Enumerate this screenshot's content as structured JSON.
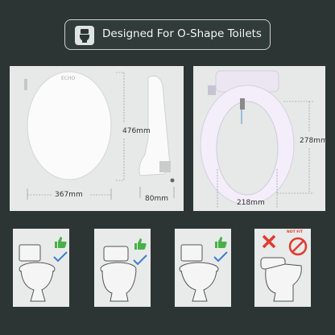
{
  "banner": {
    "title": "Designed For O-Shape Toilets",
    "icon": "toilet-icon"
  },
  "dimensions": {
    "height": "476mm",
    "width": "367mm",
    "depth": "80mm",
    "opening_height": "278mm",
    "opening_width": "218mm"
  },
  "product_brand": "ECHO",
  "compatibility": [
    {
      "toilet": "two-piece-round",
      "status": "check"
    },
    {
      "toilet": "one-piece-round",
      "status": "check"
    },
    {
      "toilet": "two-piece-elongated",
      "status": "check"
    },
    {
      "toilet": "smart-toilet",
      "status": "cross",
      "badge": "NOT FIT"
    }
  ],
  "colors": {
    "background": "#2c3533",
    "panel": "#e6e9e8",
    "check": "#49b04a",
    "cross": "#e03c2f"
  }
}
